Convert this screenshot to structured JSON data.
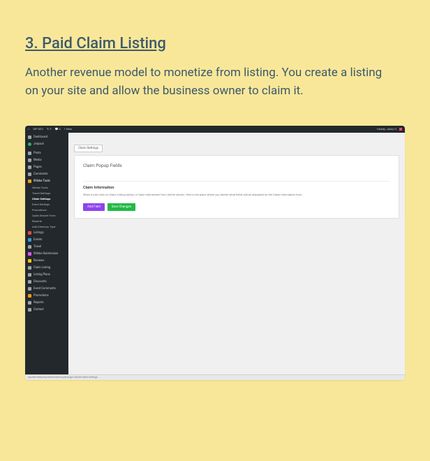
{
  "heading": "3. Paid Claim Listing",
  "body": "Another revenue model to monetize from listing. You create a listing on your site and allow the business owner to claim it.",
  "wp": {
    "topbar": {
      "site": "WP DEV",
      "updates": "9",
      "comments": "0",
      "new": "+ New",
      "howdy": "Howdy, Jacky H"
    },
    "sidebar": {
      "dashboard": "Dashboard",
      "jetpack": "Jetpack",
      "posts": "Posts",
      "media": "Media",
      "pages": "Pages",
      "comments": "Comments",
      "wiloke": "Wiloke Tools",
      "sub_wiloke_tools": "Wiloke Tools",
      "sub_travel_settings": "Travel Settings",
      "sub_claim_settings": "Claim Settings",
      "sub_event_settings": "Event Settings",
      "sub_promotions": "Promotions",
      "sub_quick_search": "Quick Search Form",
      "sub_reports": "Reports",
      "sub_add_directory": "Add Directory Type",
      "listings": "Listings",
      "events": "Events",
      "travel": "Travel",
      "submission": "Wiloke Submission",
      "reviews": "Reviews",
      "claim_listing": "Claim Listing",
      "listing_plans": "Listing Plans",
      "discounts": "Discounts",
      "event_comments": "Event Comments",
      "promotions": "Promotions",
      "reports": "Reports",
      "contact": "Contact"
    },
    "main": {
      "tab": "Claim Settings",
      "panel_title": "Claim Popup Fields",
      "section_title": "Claim Information",
      "section_desc": "When a user click on Claim Listing button, a Claim Information form will be shown. Here is the place where you decide what fields will be displayed on the Claim Information form.",
      "add_field": "Add Field",
      "save_changes": "Save Changes"
    },
    "status": "wp/live-ready/wp-admin/admin.php?page=wiloke-claim-settings"
  }
}
